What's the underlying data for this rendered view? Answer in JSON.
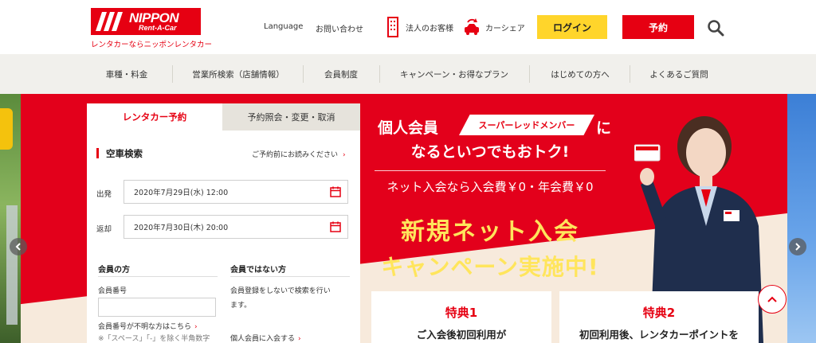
{
  "header": {
    "logo_name": "NIPPON",
    "logo_sub": "Rent-A-Car",
    "logo_tagline": "レンタカーならニッポンレンタカー",
    "language": "Language",
    "contact": "お問い合わせ",
    "corporate": "法人のお客様",
    "carshare": "カーシェア",
    "login": "ログイン",
    "reserve": "予約"
  },
  "nav": {
    "items": [
      "車種・料金",
      "営業所検索（店舗情報）",
      "会員制度",
      "キャンペーン・お得なプラン",
      "はじめての方へ",
      "よくあるご質問"
    ]
  },
  "booking": {
    "tab_reserve": "レンタカー予約",
    "tab_inquiry": "予約照会・変更・取消",
    "section_title": "空車検索",
    "notice": "ご予約前にお読みください",
    "departure_label": "出発",
    "departure_value": "2020年7月29日(水) 12:00",
    "return_label": "返却",
    "return_value": "2020年7月30日(木) 20:00",
    "member_heading": "会員の方",
    "member_number_label": "会員番号",
    "forgot_number": "会員番号が不明な方はこちら",
    "input_note": "※「スペース」「-」を除く半角数字",
    "nonmember_heading": "会員ではない方",
    "nonmember_text_1": "会員登録をしないで検索を行い",
    "nonmember_text_2": "ます。",
    "join_link": "個人会員に入会する"
  },
  "promo": {
    "line1_a": "個人会員",
    "badge": "スーパーレッドメンバー",
    "line1_b": "に",
    "line2": "なるといつでもおトク!",
    "fee": "ネット入会なら入会費￥0・年会費￥0",
    "big1": "新規ネット入会",
    "big2": "キャンペーン実施中!",
    "card1_title": "特典1",
    "card1_text": "ご入会後初回利用が",
    "card2_title": "特典2",
    "card2_text": "初回利用後、レンタカーポイントを"
  },
  "colors": {
    "brand_red": "#e60012",
    "login_yellow": "#ffd52b",
    "promo_yellow": "#ffe55c"
  }
}
